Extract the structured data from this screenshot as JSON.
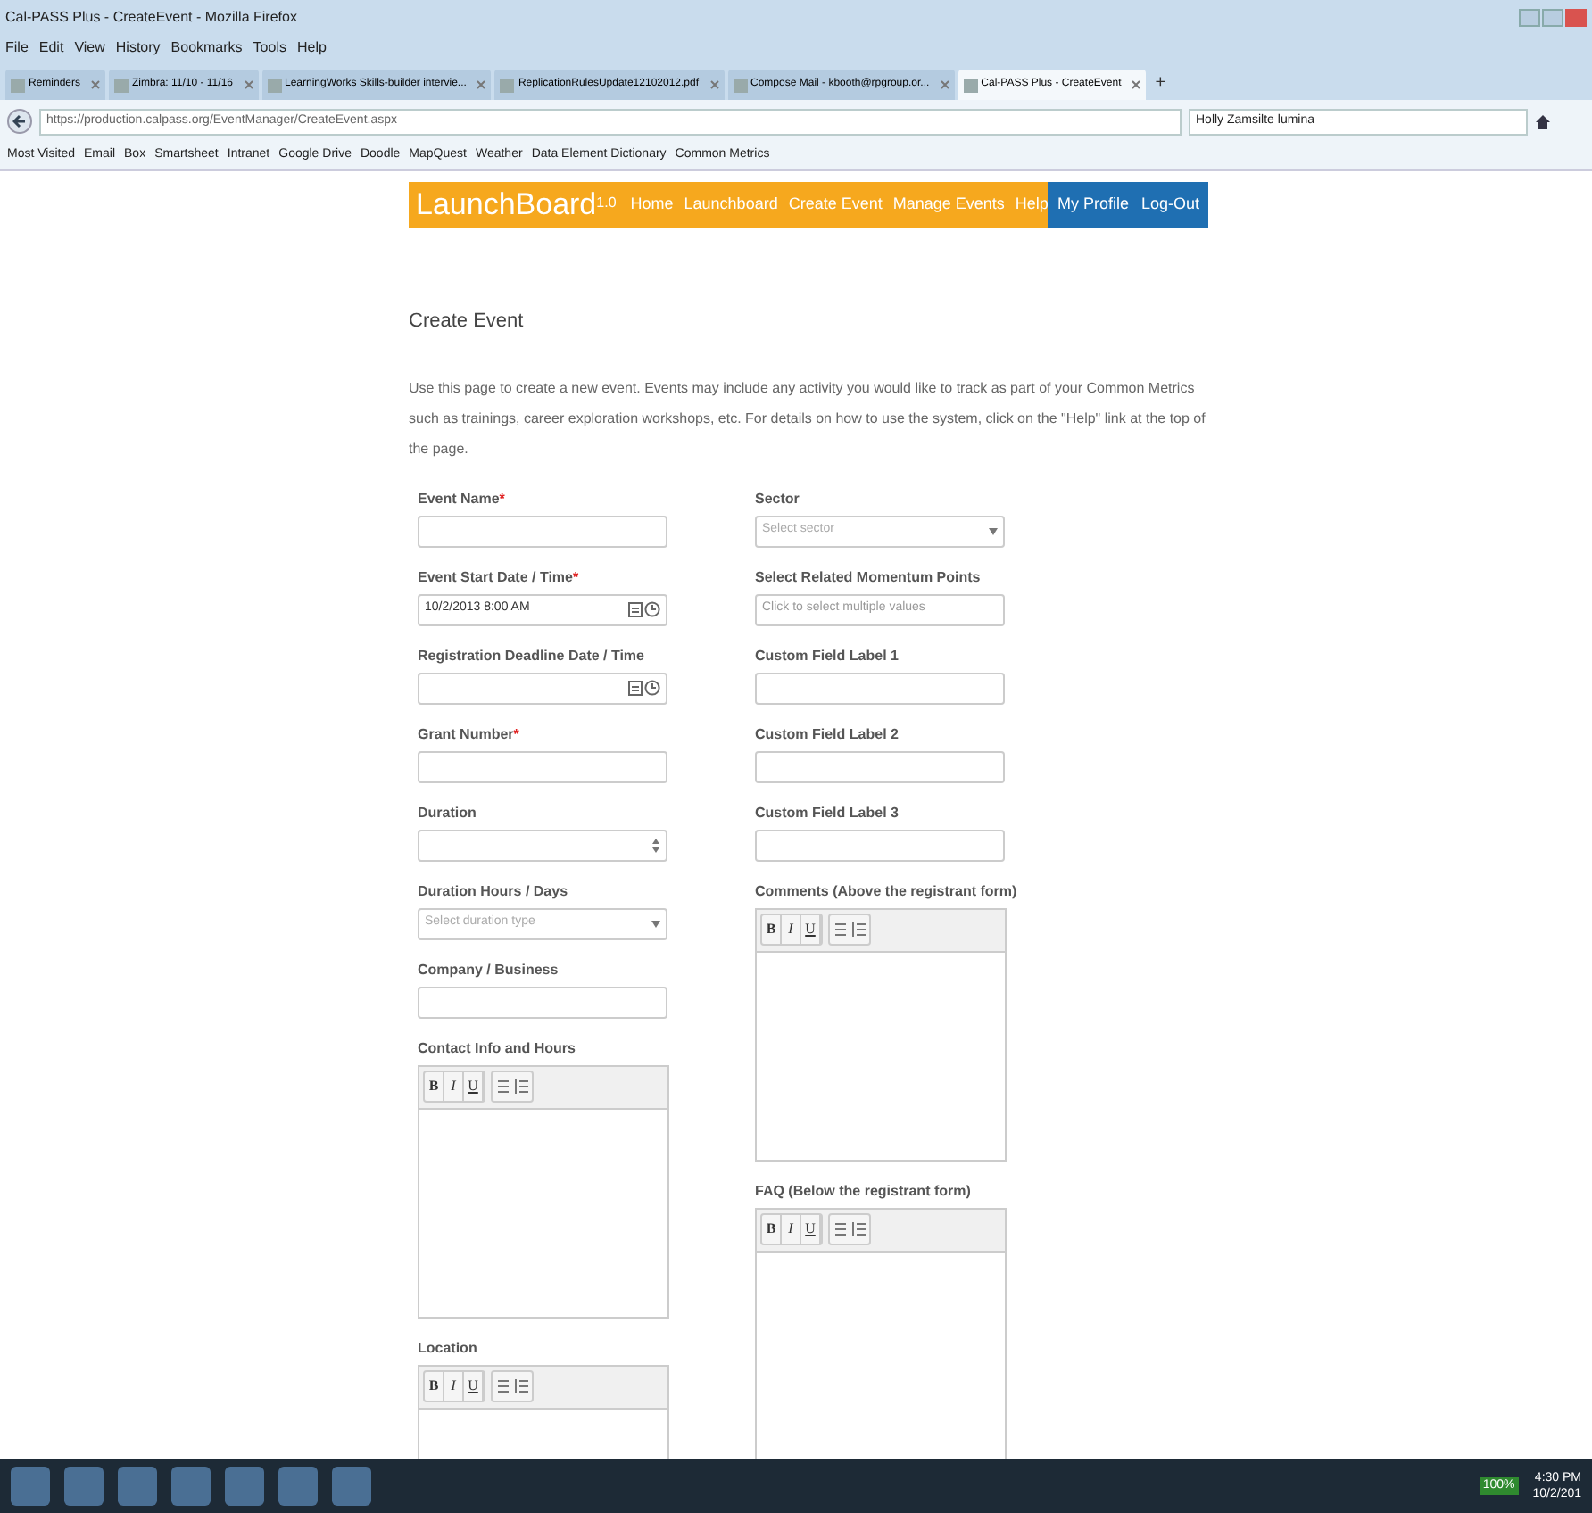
{
  "window": {
    "title": "Cal-PASS Plus - CreateEvent - Mozilla Firefox"
  },
  "menu": [
    "File",
    "Edit",
    "View",
    "History",
    "Bookmarks",
    "Tools",
    "Help"
  ],
  "tabs": [
    {
      "label": "Reminders",
      "selected": false
    },
    {
      "label": "Zimbra: 11/10 - 11/16",
      "selected": false
    },
    {
      "label": "LearningWorks Skills-builder intervie...",
      "selected": false
    },
    {
      "label": "ReplicationRulesUpdate12102012.pdf",
      "selected": false
    },
    {
      "label": "Compose Mail - kbooth@rpgroup.or...",
      "selected": false
    },
    {
      "label": "Cal-PASS Plus - CreateEvent",
      "selected": true
    }
  ],
  "new_tab": "+",
  "address": {
    "url": "https://production.calpass.org/EventManager/CreateEvent.aspx"
  },
  "search": {
    "value": "Holly Zamsilte lumina"
  },
  "bookmarks": [
    "Most Visited",
    "Email",
    "Box",
    "Smartsheet",
    "Intranet",
    "Google Drive",
    "Doodle",
    "MapQuest",
    "Weather",
    "Data Element Dictionary",
    "Common Metrics"
  ],
  "site_nav": {
    "logo": "LaunchBoard",
    "version": "1.0",
    "items": [
      {
        "label": "Home",
        "kind": "main"
      },
      {
        "label": "Launchboard",
        "kind": "main"
      },
      {
        "label": "Create Event",
        "kind": "main"
      },
      {
        "label": "Manage Events",
        "kind": "main"
      },
      {
        "label": "Help",
        "kind": "main"
      },
      {
        "label": "My Profile",
        "kind": "account"
      },
      {
        "label": "Log-Out",
        "kind": "account"
      }
    ]
  },
  "page": {
    "title": "Create Event",
    "intro": "Use this page to create a new event. Events may include any activity you would like to track as part of your Common Metrics such as trainings, career exploration workshops, etc. For details on how to use the system, click on the \"Help\" link at the top of the page."
  },
  "left_fields": [
    {
      "label": "Event Name",
      "required_mark": "*",
      "kind": "text"
    },
    {
      "label": "Event Start Date / Time",
      "required_mark": "*",
      "kind": "datetime",
      "value": "10/2/2013 8:00 AM"
    },
    {
      "label": "Registration Deadline Date / Time",
      "kind": "datetime"
    },
    {
      "label": "Grant Number",
      "required_mark": "*",
      "kind": "text"
    },
    {
      "label": "Duration",
      "kind": "number"
    },
    {
      "label": "Duration Hours / Days",
      "kind": "select",
      "placeholder": "Select duration type"
    },
    {
      "label": "Company / Business",
      "kind": "text"
    },
    {
      "label": "Contact Info and Hours",
      "kind": "editor",
      "toolbar": [
        "B",
        "I",
        "U"
      ]
    },
    {
      "label": "Location",
      "kind": "editor",
      "toolbar": [
        "B",
        "I",
        "U"
      ]
    }
  ],
  "right_fields": [
    {
      "label": "Sector",
      "kind": "select",
      "placeholder": "Select sector"
    },
    {
      "label": "Select Related Momentum Points",
      "kind": "text",
      "placeholder": "Click to select multiple values"
    },
    {
      "label": "Custom Field Label 1",
      "kind": "text"
    },
    {
      "label": "Custom Field Label 2",
      "kind": "text"
    },
    {
      "label": "Custom Field Label 3",
      "kind": "text"
    },
    {
      "label": "Comments (Above the registrant form)",
      "kind": "editor",
      "toolbar": [
        "B",
        "I",
        "U"
      ]
    },
    {
      "label": "FAQ (Below the registrant form)",
      "kind": "editor",
      "toolbar": [
        "B",
        "I",
        "U"
      ]
    }
  ],
  "taskbar": {
    "battery": "100%",
    "time": "4:30 PM",
    "date": "10/2/201"
  }
}
